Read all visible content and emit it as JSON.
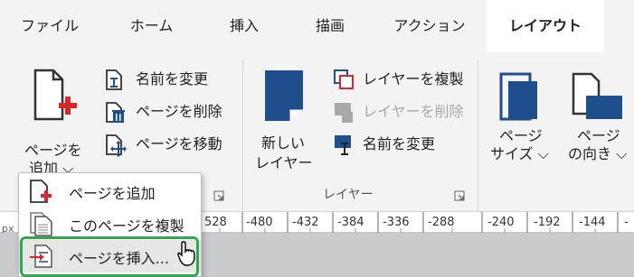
{
  "tabs": [
    {
      "label": "ファイル"
    },
    {
      "label": "ホーム"
    },
    {
      "label": "挿入"
    },
    {
      "label": "描画"
    },
    {
      "label": "アクション"
    },
    {
      "label": "レイアウト"
    }
  ],
  "ribbon": {
    "page_add": {
      "line1": "ページを",
      "line2": "追加 ⌵"
    },
    "rename_page": "名前を変更",
    "delete_page": "ページを削除",
    "move_page": "ページを移動",
    "new_layer": {
      "line1": "新しい",
      "line2": "レイヤー"
    },
    "duplicate_layer": "レイヤーを複製",
    "delete_layer": "レイヤーを削除",
    "rename_layer": "名前を変更",
    "layer_group_label": "レイヤー",
    "page_size": {
      "line1": "ページ",
      "line2": "サイズ ⌵"
    },
    "page_orientation": {
      "line1": "ページ",
      "line2": "の向き ⌵"
    }
  },
  "ruler": {
    "unit": "px",
    "ticks": [
      "528",
      "-480",
      "-432",
      "-384",
      "-336",
      "-288",
      "-240",
      "-192",
      "-144",
      "-"
    ]
  },
  "menu": {
    "items": [
      {
        "label": "ページを追加"
      },
      {
        "label": "このページを複製"
      },
      {
        "label": "ページを挿入..."
      }
    ]
  },
  "colors": {
    "accent_red": "#d9262c",
    "accent_blue": "#1f4e8c",
    "highlight_green": "#2fa84f",
    "disabled": "#a8a8a8"
  }
}
